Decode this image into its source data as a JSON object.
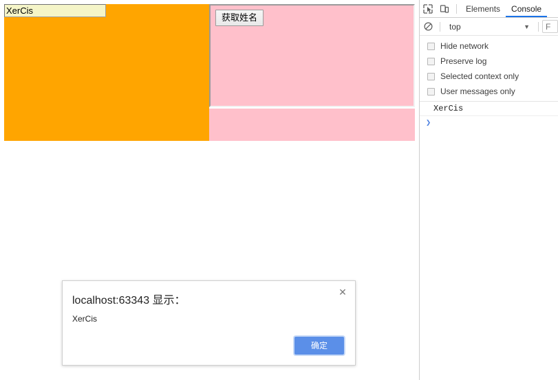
{
  "page": {
    "name_input": {
      "value": "XerCis",
      "placeholder": ""
    },
    "get_name_button_label": "获取姓名",
    "colors": {
      "orange_panel": "#ffa500",
      "pink_panel": "#ffc0cb",
      "input_background": "#f5f5c8"
    }
  },
  "alert_dialog": {
    "title": "localhost:63343 显示：",
    "message": "XerCis",
    "ok_label": "确定",
    "close_icon": "close-icon",
    "close_glyph": "✕",
    "accent_color": "#5b8fe8"
  },
  "devtools": {
    "toolbar": {
      "inspect_icon": "inspect-element-icon",
      "device_toolbar_icon": "device-toolbar-icon",
      "tabs": [
        {
          "label": "Elements",
          "active": false
        },
        {
          "label": "Console",
          "active": true
        }
      ],
      "active_tab_color": "#1a73e8"
    },
    "filterbar": {
      "clear_icon": "clear-console-icon",
      "context_value": "top",
      "context_caret": "▼",
      "filter_placeholder": "F"
    },
    "options": [
      {
        "label": "Hide network",
        "checked": false
      },
      {
        "label": "Preserve log",
        "checked": false
      },
      {
        "label": "Selected context only",
        "checked": false
      },
      {
        "label": "User messages only",
        "checked": false
      }
    ],
    "console": {
      "messages": [
        {
          "text": "XerCis"
        }
      ],
      "prompt_caret": "❯"
    }
  }
}
